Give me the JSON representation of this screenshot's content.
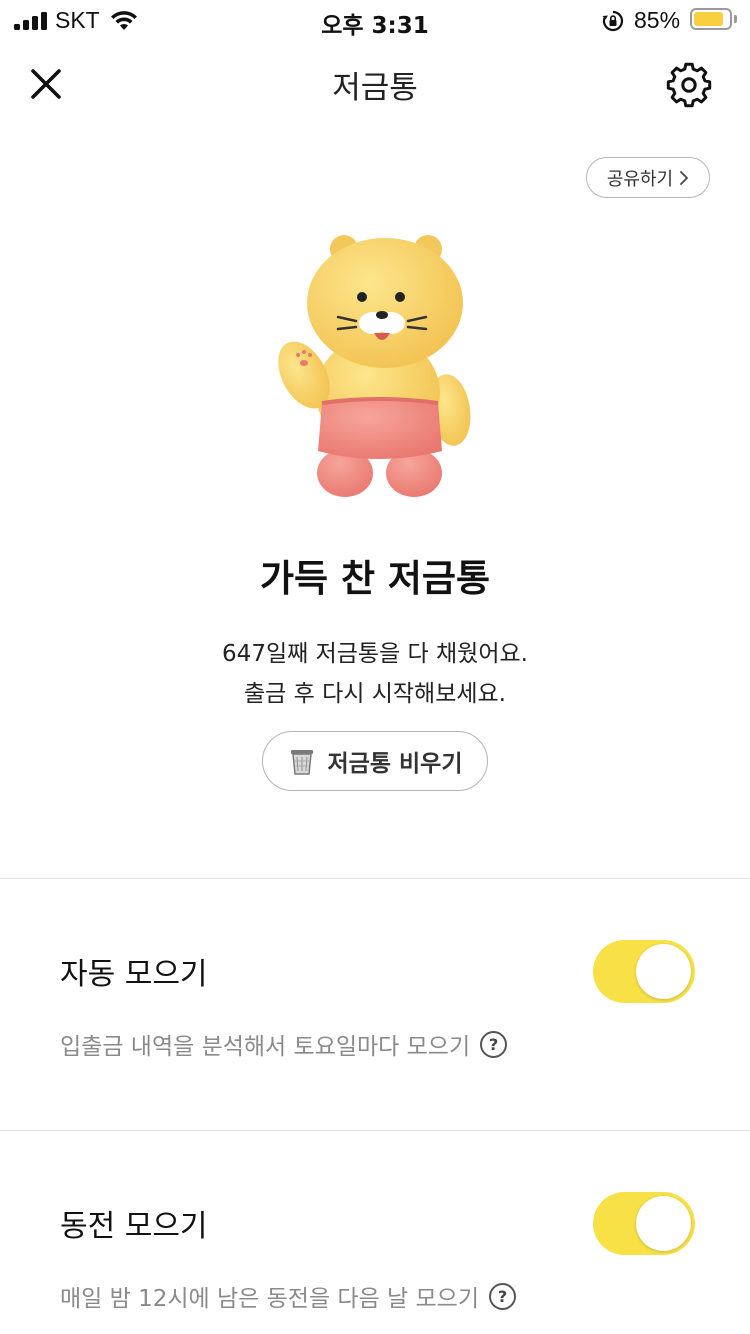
{
  "status_bar": {
    "carrier": "SKT",
    "time": "오후 3:31",
    "battery_percent": "85%",
    "battery_level": 0.85,
    "battery_color": "#f7cf40"
  },
  "nav": {
    "title": "저금통",
    "close_icon": "close-icon",
    "settings_icon": "gear-icon"
  },
  "share": {
    "label": "공유하기",
    "icon": "chevron-right-icon"
  },
  "character": {
    "icon": "cat-character-illustration"
  },
  "piggy_bank": {
    "title": "가득 찬 저금통",
    "message_line1": "647일째 저금통을 다 채웠어요.",
    "message_line2": "출금 후 다시 시작해보세요.",
    "empty_button_label": "저금통 비우기",
    "empty_button_icon": "trash-bin-icon"
  },
  "settings": [
    {
      "title": "자동 모으기",
      "description": "입출금 내역을 분석해서 토요일마다 모으기",
      "enabled": true,
      "help_label": "?"
    },
    {
      "title": "동전 모으기",
      "description": "매일 밤 12시에 남은 동전을 다음 날 모으기",
      "enabled": true,
      "help_label": "?"
    }
  ],
  "colors": {
    "toggle_on": "#f8e047",
    "character_body": "#f7d36b",
    "character_pants": "#f08f88"
  }
}
